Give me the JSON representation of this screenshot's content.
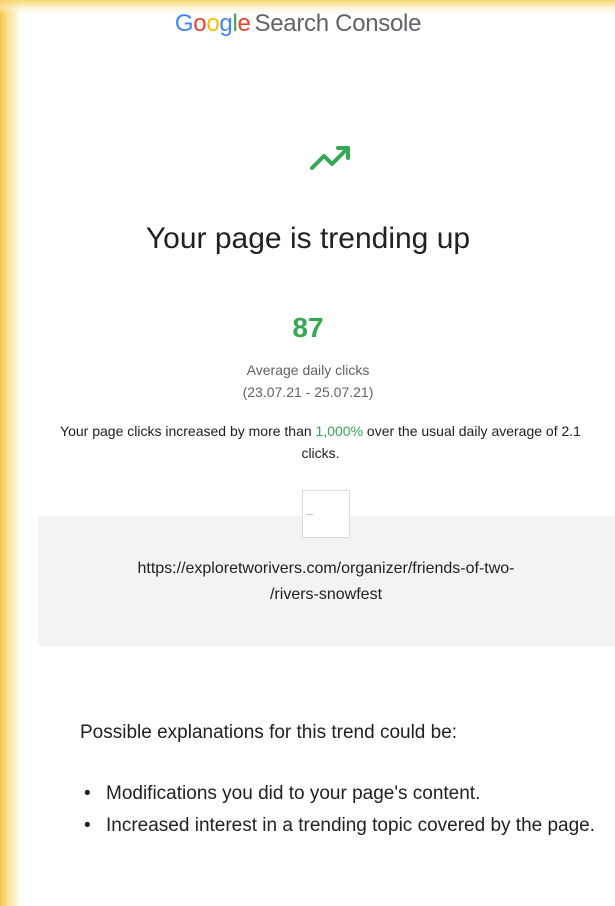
{
  "header": {
    "brand_letters": [
      {
        "char": "G",
        "color": "#4285f4"
      },
      {
        "char": "o",
        "color": "#ea4335"
      },
      {
        "char": "o",
        "color": "#fbbc05"
      },
      {
        "char": "g",
        "color": "#4285f4"
      },
      {
        "char": "l",
        "color": "#34a853"
      },
      {
        "char": "e",
        "color": "#ea4335"
      }
    ],
    "product": "Search Console"
  },
  "icon": {
    "name": "trending-up-icon",
    "color": "#34a853"
  },
  "title": "Your page is trending up",
  "metric": {
    "value": "87",
    "label": "Average daily clicks",
    "range": "(23.07.21 - 25.07.21)"
  },
  "summary": {
    "prefix": "Your page clicks increased by more than ",
    "percent": "1,000%",
    "suffix": " over the usual daily average of 2.1 clicks."
  },
  "page_link": {
    "line1": "https://exploretworivers.com/organizer/friends-of-two-",
    "line2": "/rivers-snowfest"
  },
  "explanations": {
    "heading": "Possible explanations for this trend could be:",
    "bullet": "•",
    "items": [
      "Modifications you did to your page's content.",
      "Increased interest in a trending topic covered by the page."
    ]
  },
  "colors": {
    "accent_green": "#34a853",
    "text": "#202124",
    "muted": "#5f6368",
    "url_box_bg": "#f1f4f1"
  }
}
